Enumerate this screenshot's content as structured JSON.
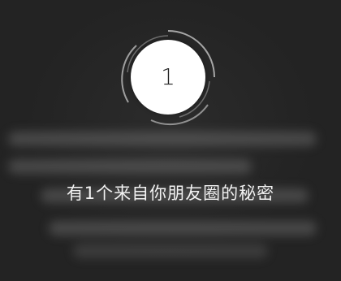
{
  "badge": {
    "number": "1"
  },
  "headline": {
    "text": "有1个来自你朋友圈的秘密"
  }
}
